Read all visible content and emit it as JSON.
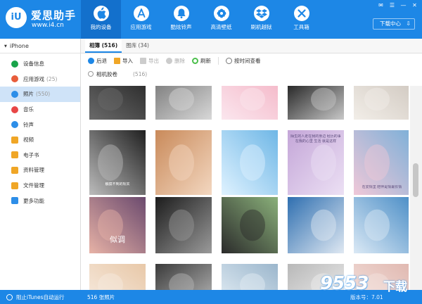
{
  "app": {
    "logo_mark": "iU",
    "name": "爱思助手",
    "url": "www.i4.cn",
    "download_center": "下载中心"
  },
  "nav": [
    {
      "label": "我的设备",
      "icon": "apple-icon",
      "active": true
    },
    {
      "label": "应用游戏",
      "icon": "app-store-icon"
    },
    {
      "label": "酷炫铃声",
      "icon": "bell-icon"
    },
    {
      "label": "高清壁纸",
      "icon": "flower-icon"
    },
    {
      "label": "刷机越狱",
      "icon": "dropbox-icon"
    },
    {
      "label": "工具箱",
      "icon": "tools-icon"
    }
  ],
  "window_controls": [
    "feedback-icon",
    "menu-icon",
    "minimize-icon",
    "close-icon"
  ],
  "device": {
    "name": "iPhone"
  },
  "sidebar": [
    {
      "label": "设备信息",
      "count": "",
      "icon": "info-icon",
      "color": "#19a34a"
    },
    {
      "label": "应用游戏",
      "count": "(25)",
      "icon": "apps-icon",
      "color": "#e85d3b"
    },
    {
      "label": "照片",
      "count": "(550)",
      "icon": "photo-icon",
      "color": "#2d8ee8",
      "active": true
    },
    {
      "label": "音乐",
      "count": "",
      "icon": "music-icon",
      "color": "#e84646"
    },
    {
      "label": "铃声",
      "count": "",
      "icon": "bell-icon",
      "color": "#2d8ee8"
    },
    {
      "label": "视频",
      "count": "",
      "icon": "video-icon",
      "color": "#f0a626"
    },
    {
      "label": "电子书",
      "count": "",
      "icon": "book-icon",
      "color": "#f0a626"
    },
    {
      "label": "资料管理",
      "count": "",
      "icon": "contacts-icon",
      "color": "#f0a626"
    },
    {
      "label": "文件管理",
      "count": "",
      "icon": "folder-icon",
      "color": "#f0a626"
    },
    {
      "label": "更多功能",
      "count": "",
      "icon": "more-icon",
      "color": "#2d8ee8"
    }
  ],
  "tabs": [
    {
      "label": "相簿 (516)",
      "active": true
    },
    {
      "label": "图库 (34)"
    }
  ],
  "toolbar": {
    "back": "后退",
    "import": "导入",
    "export": "导出",
    "delete": "删除",
    "refresh": "刷新",
    "sort_by_time": "按时间查看"
  },
  "album": {
    "name": "相机胶卷",
    "count": "(516)"
  },
  "photo_captions": {
    "r2c1": "触摸不到的现实",
    "r2c4": "陌生的人走在我的身边 经历的事在我的心里 生活 就是这样",
    "r2c5": "在爱情里 陪伴是情最长情",
    "r3c1": "似调"
  },
  "status": {
    "itunes": "阻止iTunes自动运行",
    "photo_count": "516 张照片",
    "version": "版本号：7.01"
  },
  "watermark": {
    "main": "9553",
    "sub": "下载"
  }
}
